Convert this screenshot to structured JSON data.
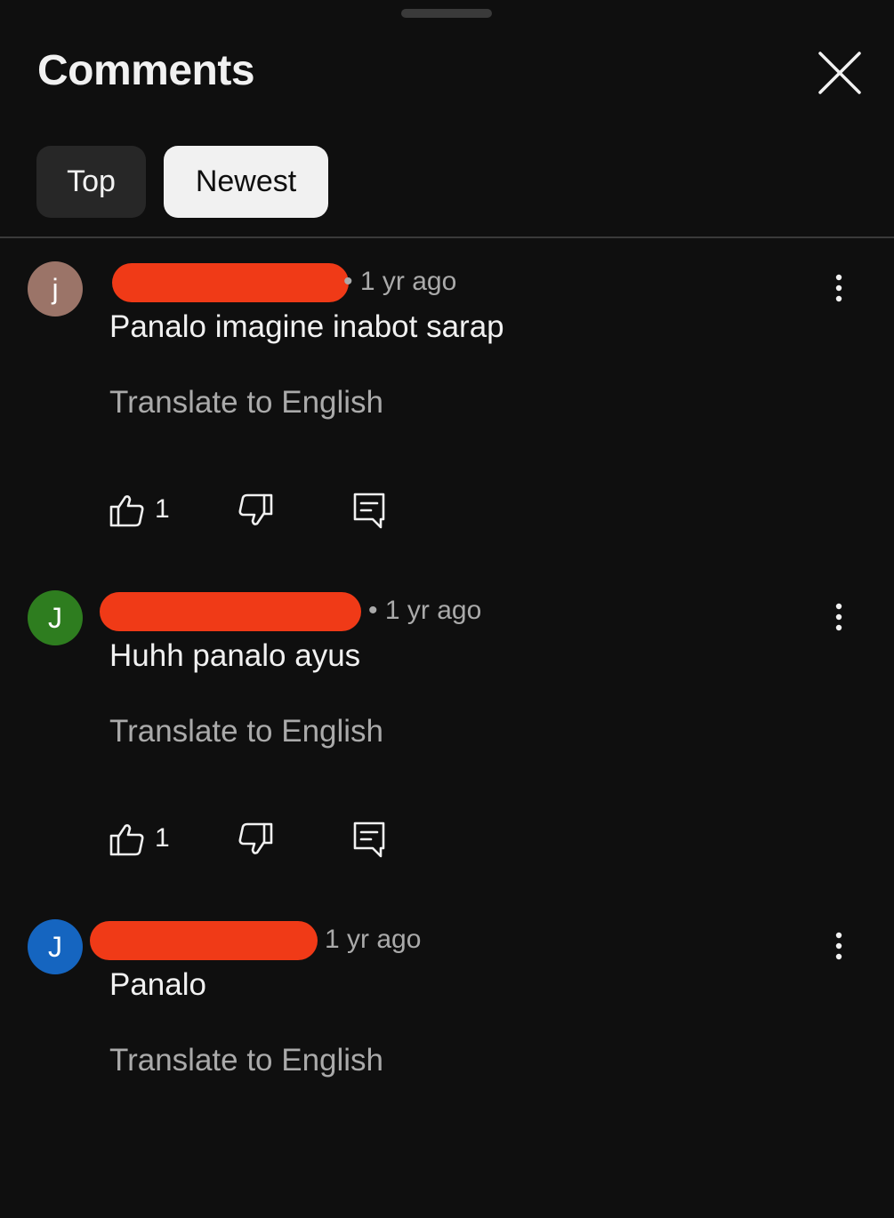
{
  "header": {
    "title": "Comments",
    "close_icon": "close-icon"
  },
  "filters": [
    {
      "label": "Top",
      "selected": false
    },
    {
      "label": "Newest",
      "selected": true
    }
  ],
  "colors": {
    "background": "#0f0f0f",
    "chip_selected": "#f1f1f1",
    "chip_unselected": "#272727",
    "redaction": "#f03a17",
    "secondary_text": "#aaaaaa"
  },
  "comments": [
    {
      "avatar_letter": "j",
      "avatar_color": "#9b7468",
      "author_redacted": true,
      "time_prefix": "•",
      "time": "1 yr ago",
      "text": "Panalo imagine inabot sarap",
      "translate_label": "Translate to English",
      "likes": "1"
    },
    {
      "avatar_letter": "J",
      "avatar_color": "#2e7d1f",
      "author_redacted": true,
      "time_prefix": "•",
      "time": "1 yr ago",
      "text": "Huhh panalo ayus",
      "translate_label": "Translate to English",
      "likes": "1"
    },
    {
      "avatar_letter": "J",
      "avatar_color": "#1565c0",
      "author_redacted": true,
      "time_prefix": "",
      "time": "1 yr ago",
      "text": "Panalo",
      "translate_label": "Translate to English",
      "likes": ""
    }
  ],
  "icons": {
    "like": "thumb-up-icon",
    "dislike": "thumb-down-icon",
    "reply": "reply-icon",
    "more": "more-vertical-icon"
  }
}
